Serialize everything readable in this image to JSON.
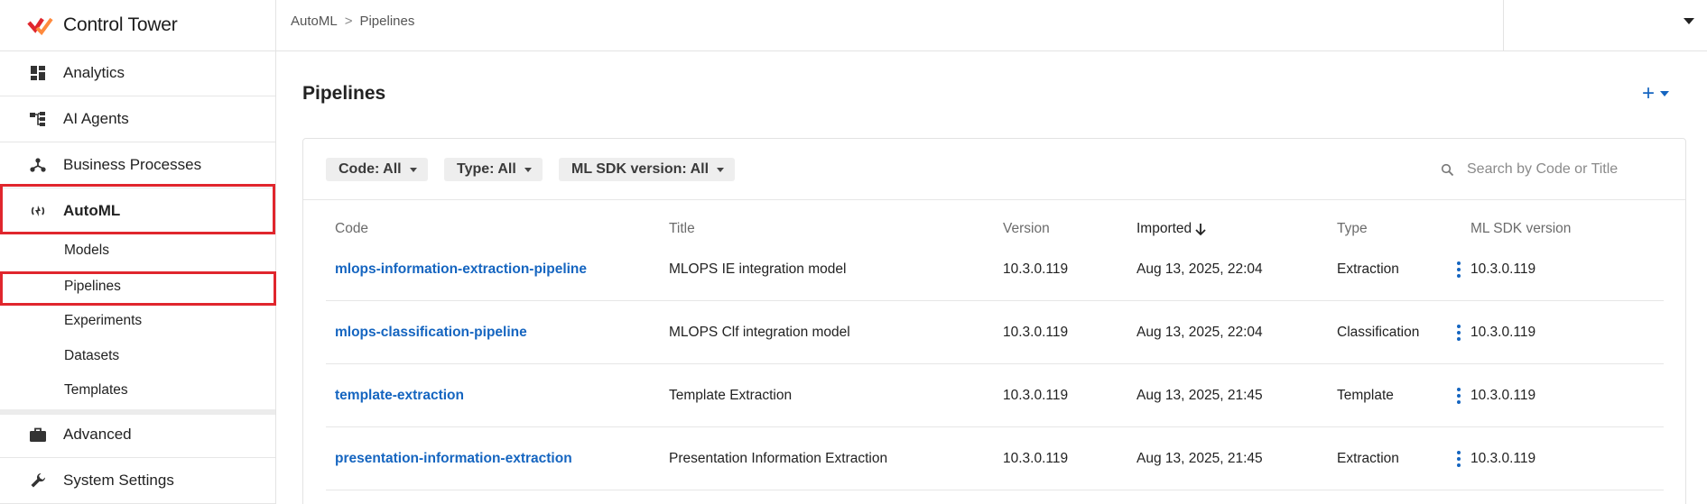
{
  "app": {
    "name": "Control Tower",
    "accent": "#e0262d",
    "link_color": "#1565c0"
  },
  "breadcrumb": {
    "items": [
      "AutoML",
      "Pipelines"
    ]
  },
  "sidebar": {
    "items": [
      {
        "label": "Analytics",
        "icon": "dashboard-icon"
      },
      {
        "label": "AI Agents",
        "icon": "hierarchy-icon"
      },
      {
        "label": "Business Processes",
        "icon": "process-nodes-icon"
      },
      {
        "label": "AutoML",
        "icon": "automl-icon",
        "active": true
      },
      {
        "label": "Advanced",
        "icon": "briefcase-icon"
      },
      {
        "label": "System Settings",
        "icon": "wrench-icon"
      }
    ],
    "automl_subitems": [
      "Models",
      "Pipelines",
      "Experiments",
      "Datasets",
      "Templates"
    ],
    "selected_subitem": "Pipelines"
  },
  "main": {
    "title": "Pipelines",
    "add_label": "+",
    "filters": [
      {
        "label": "Code: All"
      },
      {
        "label": "Type: All"
      },
      {
        "label": "ML SDK version: All"
      }
    ],
    "search": {
      "placeholder": "Search by Code or Title"
    },
    "table": {
      "columns": [
        "Code",
        "Title",
        "Version",
        "Imported",
        "Type",
        "ML SDK version"
      ],
      "sort": {
        "column": "Imported",
        "direction": "desc"
      },
      "rows": [
        {
          "code": "mlops-information-extraction-pipeline",
          "title": "MLOPS IE integration model",
          "version": "10.3.0.119",
          "imported": "Aug 13, 2025, 22:04",
          "type": "Extraction",
          "sdk": "10.3.0.119"
        },
        {
          "code": "mlops-classification-pipeline",
          "title": "MLOPS Clf integration model",
          "version": "10.3.0.119",
          "imported": "Aug 13, 2025, 22:04",
          "type": "Classification",
          "sdk": "10.3.0.119"
        },
        {
          "code": "template-extraction",
          "title": "Template Extraction",
          "version": "10.3.0.119",
          "imported": "Aug 13, 2025, 21:45",
          "type": "Template",
          "sdk": "10.3.0.119"
        },
        {
          "code": "presentation-information-extraction",
          "title": "Presentation Information Extraction",
          "version": "10.3.0.119",
          "imported": "Aug 13, 2025, 21:45",
          "type": "Extraction",
          "sdk": "10.3.0.119"
        }
      ]
    }
  }
}
